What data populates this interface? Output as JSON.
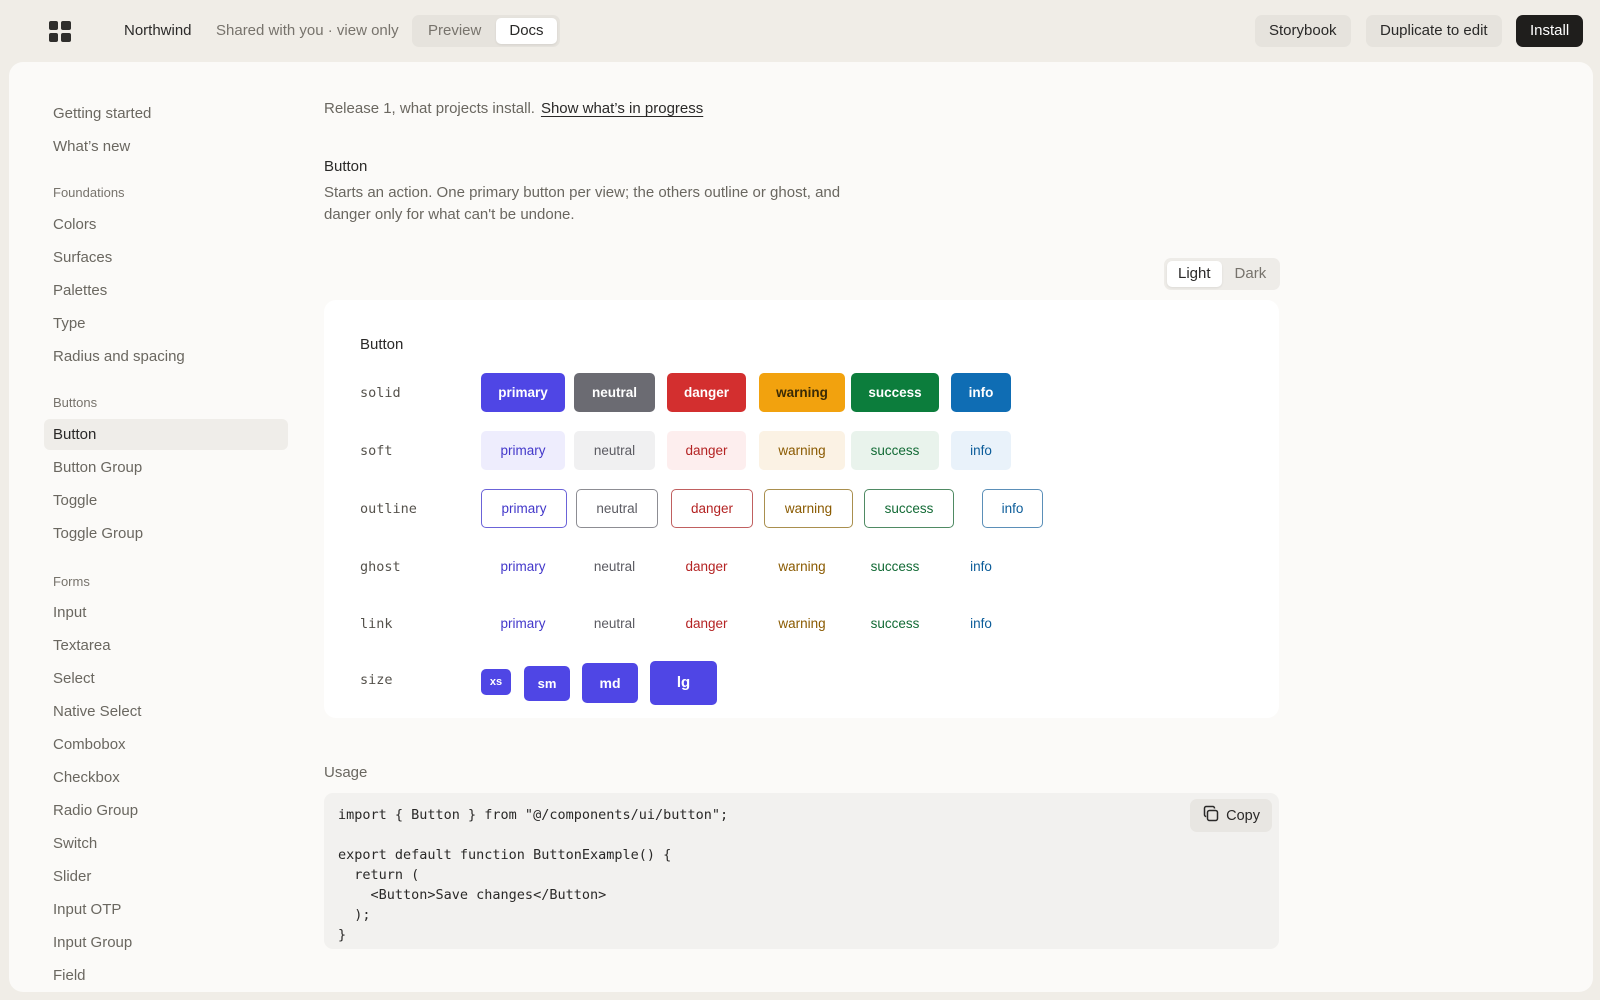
{
  "header": {
    "brand": "Northwind",
    "shared_note": "Shared with you · view only",
    "view_tabs": [
      {
        "label": "Preview",
        "active": false
      },
      {
        "label": "Docs",
        "active": true
      }
    ],
    "storybook_label": "Storybook",
    "duplicate_label": "Duplicate to edit",
    "install_label": "Install"
  },
  "sidebar": {
    "top_items": [
      "Getting started",
      "What’s new"
    ],
    "foundations": {
      "title": "Foundations",
      "items": [
        "Colors",
        "Surfaces",
        "Palettes",
        "Type",
        "Radius and spacing"
      ]
    },
    "buttons": {
      "title": "Buttons",
      "items": [
        "Button",
        "Button Group",
        "Toggle",
        "Toggle Group"
      ],
      "active": "Button"
    },
    "forms": {
      "title": "Forms",
      "items": [
        "Input",
        "Textarea",
        "Select",
        "Native Select",
        "Combobox",
        "Checkbox",
        "Radio Group",
        "Switch",
        "Slider",
        "Input OTP",
        "Input Group",
        "Field"
      ]
    }
  },
  "content": {
    "release_text": "Release 1, what projects install.",
    "release_link": "Show what’s in progress",
    "component_title": "Button",
    "component_description": "Starts an action. One primary button per view; the others outline or ghost, and danger only for what can't be undone.",
    "theme_options": [
      {
        "label": "Light",
        "active": true
      },
      {
        "label": "Dark",
        "active": false
      }
    ],
    "demo": {
      "title": "Button",
      "variants": [
        "solid",
        "soft",
        "outline",
        "ghost",
        "link"
      ],
      "intents": [
        "primary",
        "neutral",
        "danger",
        "warning",
        "success",
        "info"
      ],
      "size_label": "size",
      "sizes": [
        "xs",
        "sm",
        "md",
        "lg"
      ]
    },
    "usage_label": "Usage",
    "code": "import { Button } from \"@/components/ui/button\";\n\nexport default function ButtonExample() {\n  return (\n    <Button>Save changes</Button>\n  );\n}",
    "copy_label": "Copy"
  },
  "colors": {
    "primary": "#4f46e5",
    "neutral": "#6b6b72",
    "danger": "#d32f2f",
    "warning": "#f2a20e",
    "success": "#0c7d3c",
    "info": "#0f6db4"
  }
}
